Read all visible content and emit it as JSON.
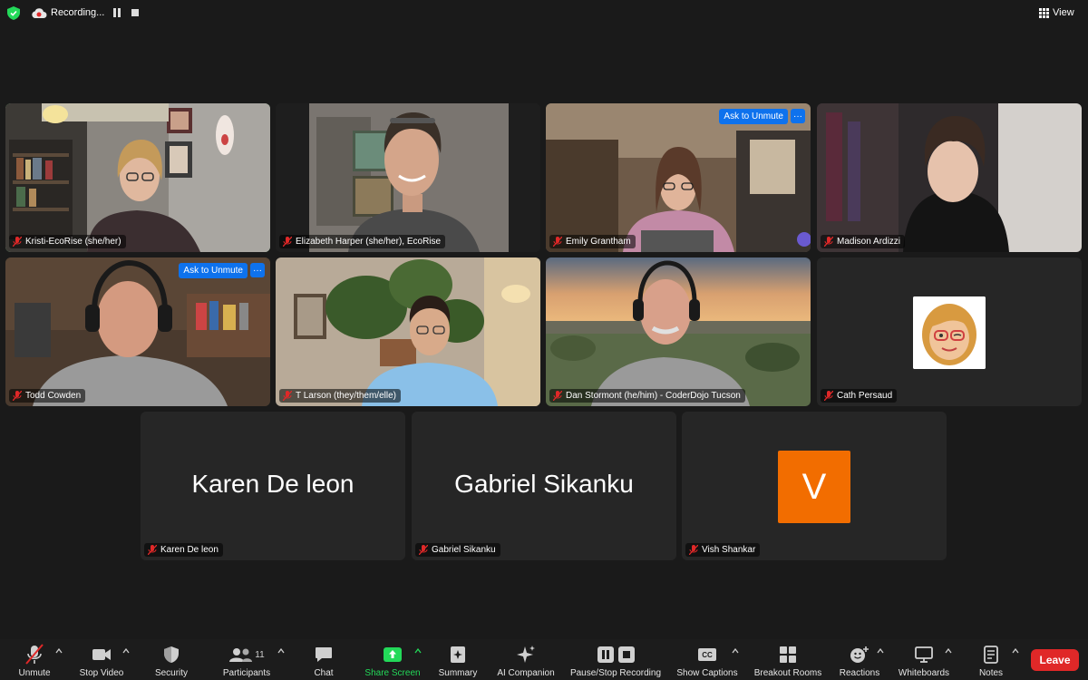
{
  "top_bar": {
    "recording_label": "Recording...",
    "view_label": "View"
  },
  "participants": [
    {
      "name": "Kristi-EcoRise (she/her)"
    },
    {
      "name": "Elizabeth Harper (she/her), EcoRise"
    },
    {
      "name": "Emily Grantham",
      "ask_to_unmute": "Ask to Unmute"
    },
    {
      "name": "Madison Ardizzi"
    },
    {
      "name": "Todd Cowden",
      "ask_to_unmute": "Ask to Unmute"
    },
    {
      "name": "T Larson (they/them/elle)"
    },
    {
      "name": "Dan Stormont (he/him) - CoderDojo Tucson"
    },
    {
      "name": "Cath Persaud"
    },
    {
      "name": "Karen De leon",
      "display_name": "Karen De leon"
    },
    {
      "name": "Gabriel Sikanku",
      "display_name": "Gabriel Sikanku"
    },
    {
      "name": "Vish Shankar",
      "avatar_letter": "V"
    }
  ],
  "more_options": "···",
  "toolbar": {
    "unmute": "Unmute",
    "stop_video": "Stop Video",
    "security": "Security",
    "participants": "Participants",
    "participants_count": "11",
    "chat": "Chat",
    "share_screen": "Share Screen",
    "summary": "Summary",
    "ai_companion": "AI Companion",
    "pause_stop_recording": "Pause/Stop Recording",
    "show_captions": "Show Captions",
    "captions_icon_text": "CC",
    "breakout_rooms": "Breakout Rooms",
    "reactions": "Reactions",
    "whiteboards": "Whiteboards",
    "notes": "Notes",
    "leave": "Leave"
  },
  "colors": {
    "background": "#1a1a1a",
    "tile": "#262626",
    "active_speaker": "#39d353",
    "accent_blue": "#0e72ed",
    "leave_red": "#e02828",
    "share_green": "#23d959",
    "avatar_orange": "#f26d00"
  }
}
